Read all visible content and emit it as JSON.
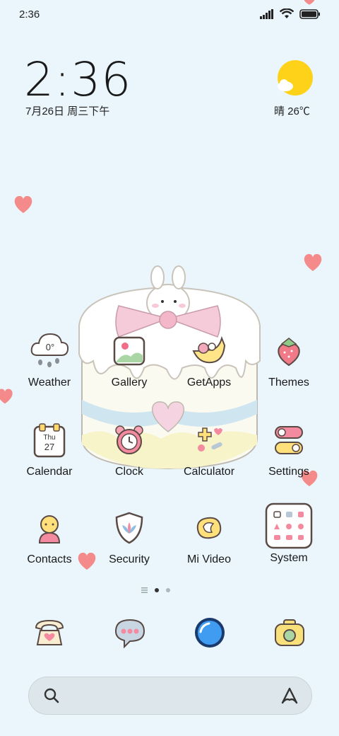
{
  "status_bar": {
    "time": "2:36"
  },
  "widget": {
    "time": "2:36",
    "date": "7月26日 周三下午",
    "weather": "晴 26℃"
  },
  "apps": [
    {
      "label": "Weather",
      "icon": "weather-cloud-icon",
      "temp": "0°"
    },
    {
      "label": "Gallery",
      "icon": "gallery-icon"
    },
    {
      "label": "GetApps",
      "icon": "getapps-icon"
    },
    {
      "label": "Themes",
      "icon": "strawberry-icon"
    },
    {
      "label": "Calendar",
      "icon": "calendar-icon",
      "day": "Thu",
      "date": "27"
    },
    {
      "label": "Clock",
      "icon": "alarm-clock-icon"
    },
    {
      "label": "Calculator",
      "icon": "calculator-icon"
    },
    {
      "label": "Settings",
      "icon": "toggle-settings-icon"
    },
    {
      "label": "Contacts",
      "icon": "contacts-icon"
    },
    {
      "label": "Security",
      "icon": "shield-icon"
    },
    {
      "label": "Mi Video",
      "icon": "video-icon"
    },
    {
      "label": "System",
      "icon": "folder-grid-icon"
    }
  ],
  "dock": [
    {
      "icon": "phone-icon"
    },
    {
      "icon": "messages-icon"
    },
    {
      "icon": "browser-icon"
    },
    {
      "icon": "camera-icon"
    }
  ],
  "colors": {
    "background": "#eaf6fb",
    "heart": "#f48a8a",
    "sun": "#ffd21a"
  }
}
